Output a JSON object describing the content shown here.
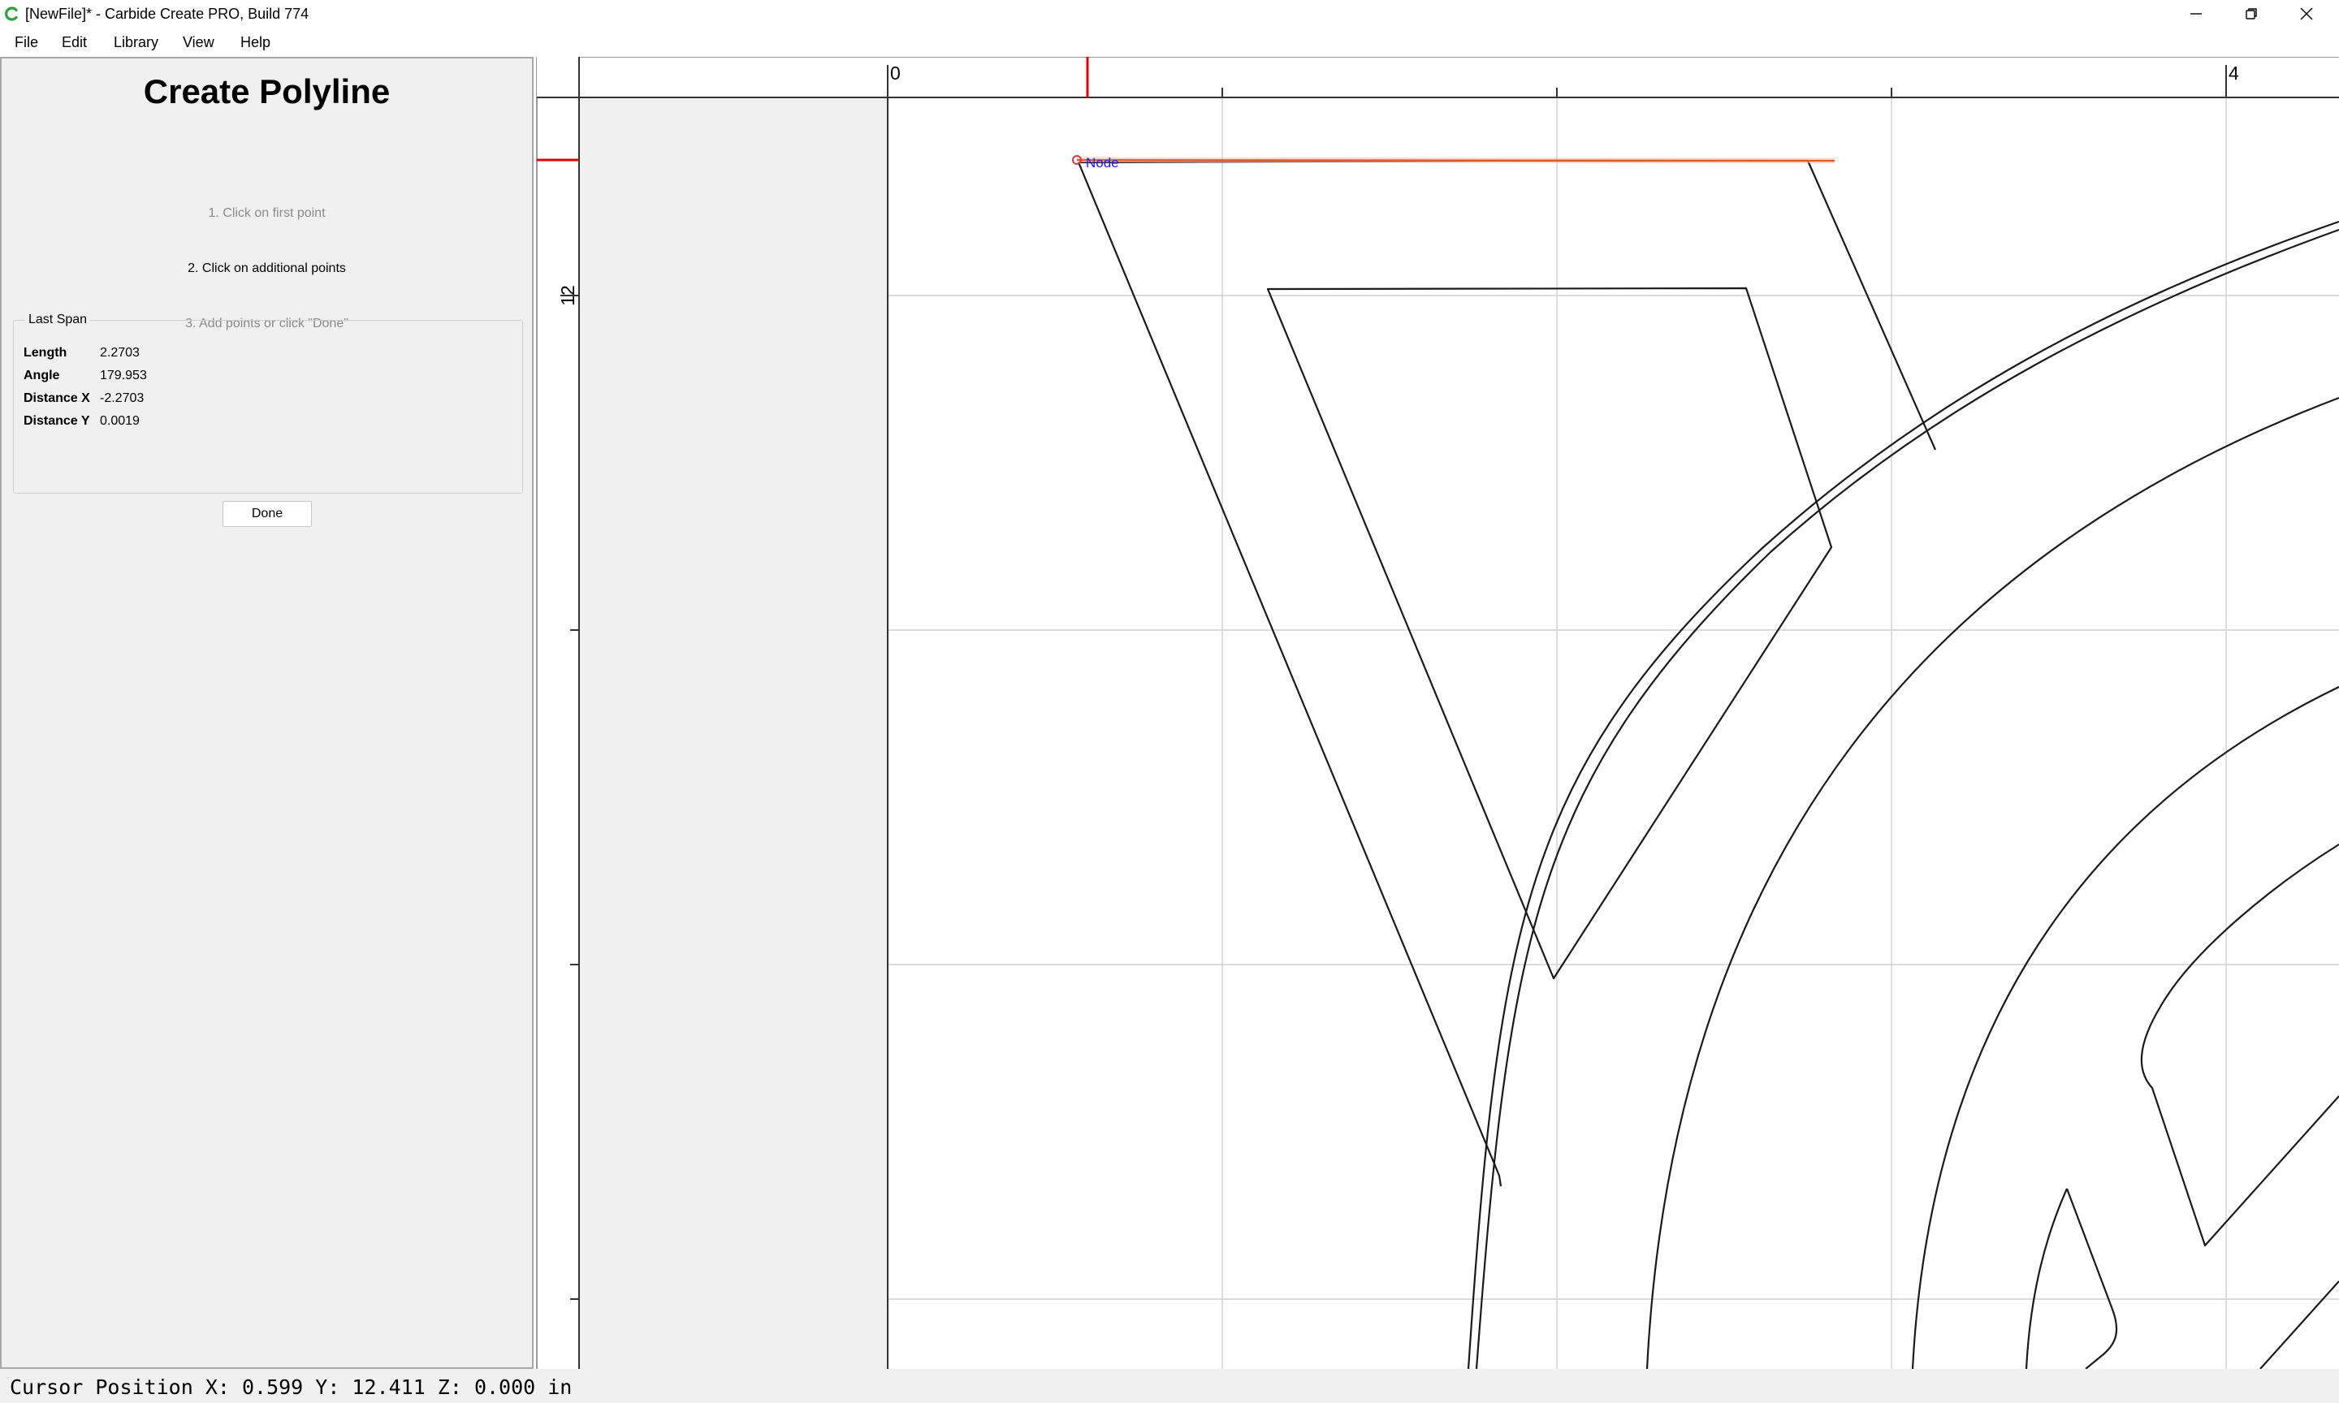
{
  "window": {
    "title": "[NewFile]* - Carbide Create PRO, Build 774",
    "app_icon": "carbide-c-icon",
    "controls": [
      "minimize-icon",
      "restore-icon",
      "close-icon"
    ]
  },
  "menu": {
    "items": [
      {
        "label": "File"
      },
      {
        "label": "Edit"
      },
      {
        "label": "Library"
      },
      {
        "label": "View"
      },
      {
        "label": "Help"
      }
    ]
  },
  "panel": {
    "title": "Create Polyline",
    "steps": [
      {
        "label": "1. Click on first point",
        "state": "done"
      },
      {
        "label": "2. Click on additional points",
        "state": "active"
      },
      {
        "label": "3. Add points or click \"Done\"",
        "state": "pending"
      }
    ],
    "last_span": {
      "legend": "Last Span",
      "rows": [
        {
          "label": "Length",
          "value": "2.2703"
        },
        {
          "label": "Angle",
          "value": "179.953"
        },
        {
          "label": "Distance X",
          "value": "-2.2703"
        },
        {
          "label": "Distance Y",
          "value": "0.0019"
        }
      ]
    },
    "done_label": "Done"
  },
  "canvas": {
    "ruler_top_labels": [
      "0",
      "4"
    ],
    "ruler_left_labels": [
      "12"
    ],
    "node_label": "Node",
    "colors": {
      "cursor_marker": "#e00000",
      "active_segment": "#e0572a",
      "node_label": "#1a1aff",
      "geometry": "#1a1a1a",
      "grid": "#d0d0d0",
      "offcanvas": "#f0f0f0"
    }
  },
  "status": {
    "cursor_position": "Cursor Position X: 0.599 Y: 12.411 Z: 0.000 in"
  }
}
